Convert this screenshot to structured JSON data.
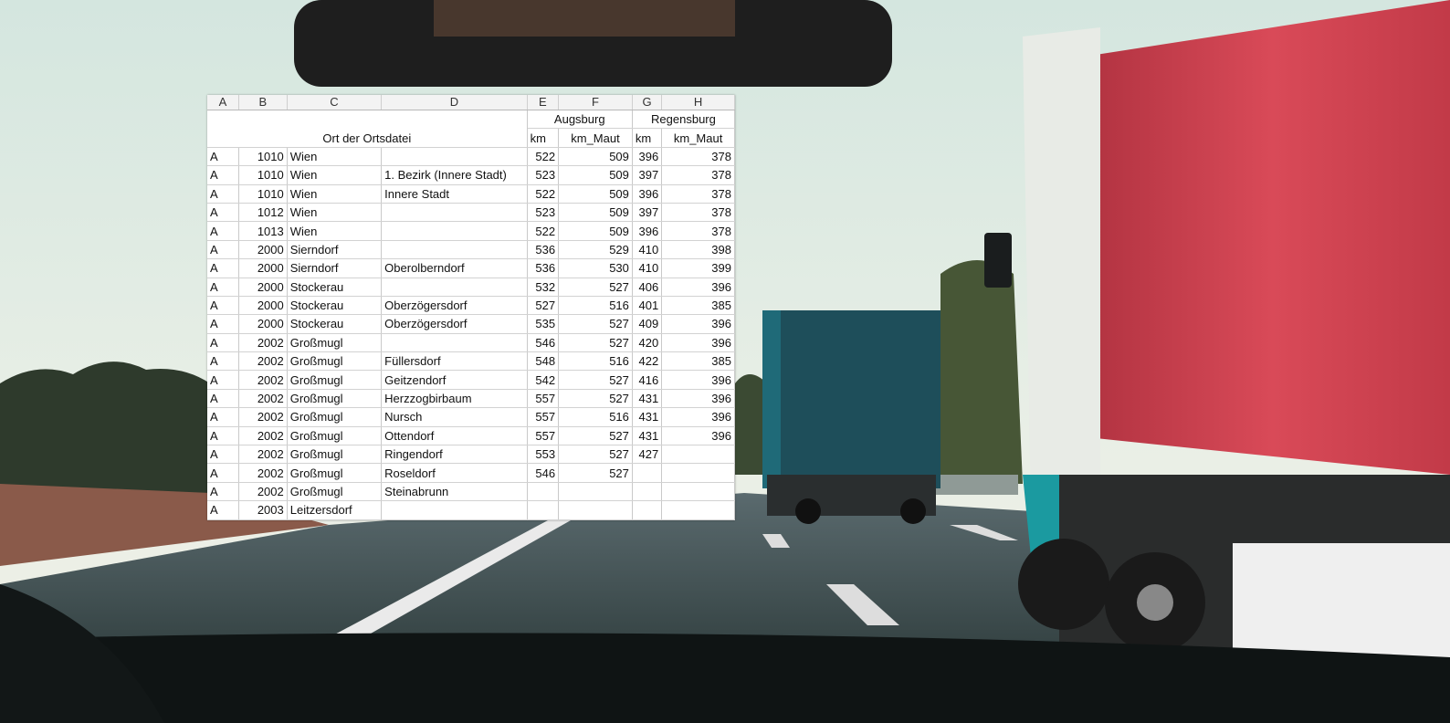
{
  "colors": {
    "sky": "#dde9e2",
    "truck_red": "#c63b49",
    "truck_blue": "#2c6e7e",
    "road": "#2d3a3e"
  },
  "sheet": {
    "column_headers": [
      "A",
      "B",
      "C",
      "D",
      "E",
      "F",
      "G",
      "H"
    ],
    "header": {
      "place_label": "Ort der Ortsdatei",
      "city1": "Augsburg",
      "city2": "Regensburg",
      "km": "km",
      "km_maut": "km_Maut"
    },
    "rows": [
      {
        "a": "A",
        "b": "1010",
        "c": "Wien",
        "d": "",
        "e": "522",
        "f": "509",
        "g": "396",
        "h": "378"
      },
      {
        "a": "A",
        "b": "1010",
        "c": "Wien",
        "d": "1. Bezirk (Innere Stadt)",
        "e": "523",
        "f": "509",
        "g": "397",
        "h": "378"
      },
      {
        "a": "A",
        "b": "1010",
        "c": "Wien",
        "d": "Innere Stadt",
        "e": "522",
        "f": "509",
        "g": "396",
        "h": "378"
      },
      {
        "a": "A",
        "b": "1012",
        "c": "Wien",
        "d": "",
        "e": "523",
        "f": "509",
        "g": "397",
        "h": "378"
      },
      {
        "a": "A",
        "b": "1013",
        "c": "Wien",
        "d": "",
        "e": "522",
        "f": "509",
        "g": "396",
        "h": "378"
      },
      {
        "a": "A",
        "b": "2000",
        "c": "Sierndorf",
        "d": "",
        "e": "536",
        "f": "529",
        "g": "410",
        "h": "398"
      },
      {
        "a": "A",
        "b": "2000",
        "c": "Sierndorf",
        "d": "Oberolberndorf",
        "e": "536",
        "f": "530",
        "g": "410",
        "h": "399"
      },
      {
        "a": "A",
        "b": "2000",
        "c": "Stockerau",
        "d": "",
        "e": "532",
        "f": "527",
        "g": "406",
        "h": "396"
      },
      {
        "a": "A",
        "b": "2000",
        "c": "Stockerau",
        "d": "Oberzögersdorf",
        "e": "527",
        "f": "516",
        "g": "401",
        "h": "385"
      },
      {
        "a": "A",
        "b": "2000",
        "c": "Stockerau",
        "d": "Oberzögersdorf",
        "e": "535",
        "f": "527",
        "g": "409",
        "h": "396"
      },
      {
        "a": "A",
        "b": "2002",
        "c": "Großmugl",
        "d": "",
        "e": "546",
        "f": "527",
        "g": "420",
        "h": "396"
      },
      {
        "a": "A",
        "b": "2002",
        "c": "Großmugl",
        "d": "Füllersdorf",
        "e": "548",
        "f": "516",
        "g": "422",
        "h": "385"
      },
      {
        "a": "A",
        "b": "2002",
        "c": "Großmugl",
        "d": "Geitzendorf",
        "e": "542",
        "f": "527",
        "g": "416",
        "h": "396"
      },
      {
        "a": "A",
        "b": "2002",
        "c": "Großmugl",
        "d": "Herzzogbirbaum",
        "e": "557",
        "f": "527",
        "g": "431",
        "h": "396"
      },
      {
        "a": "A",
        "b": "2002",
        "c": "Großmugl",
        "d": "Nursch",
        "e": "557",
        "f": "516",
        "g": "431",
        "h": "396"
      },
      {
        "a": "A",
        "b": "2002",
        "c": "Großmugl",
        "d": "Ottendorf",
        "e": "557",
        "f": "527",
        "g": "431",
        "h": "396"
      },
      {
        "a": "A",
        "b": "2002",
        "c": "Großmugl",
        "d": "Ringendorf",
        "e": "553",
        "f": "527",
        "g": "427",
        "h": ""
      },
      {
        "a": "A",
        "b": "2002",
        "c": "Großmugl",
        "d": "Roseldorf",
        "e": "546",
        "f": "527",
        "g": "",
        "h": ""
      },
      {
        "a": "A",
        "b": "2002",
        "c": "Großmugl",
        "d": "Steinabrunn",
        "e": "",
        "f": "",
        "g": "",
        "h": ""
      },
      {
        "a": "A",
        "b": "2003",
        "c": "Leitzersdorf",
        "d": "",
        "e": "",
        "f": "",
        "g": "",
        "h": ""
      }
    ]
  }
}
